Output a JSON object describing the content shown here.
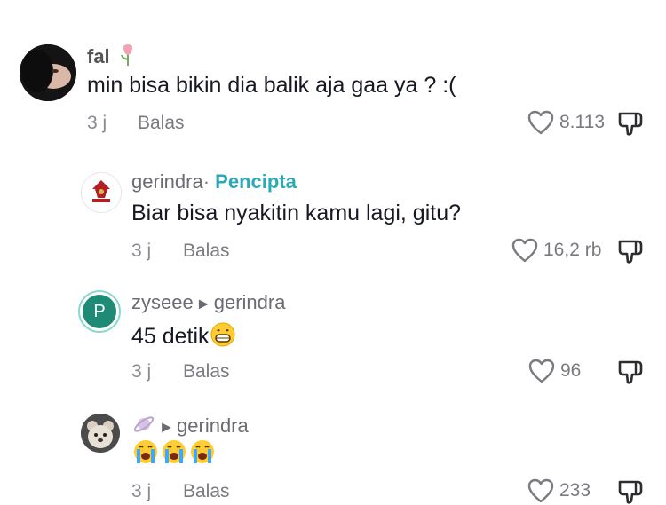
{
  "comments": [
    {
      "author": "fal",
      "text": "min bisa bikin dia balik aja gaa ya ? :(",
      "time": "3 j",
      "reply_label": "Balas",
      "likes": "8.113"
    },
    {
      "author": "gerindra",
      "separator": "·",
      "badge": "Pencipta",
      "text": "Biar bisa nyakitin kamu lagi, gitu?",
      "time": "3 j",
      "reply_label": "Balas",
      "likes": "16,2 rb"
    },
    {
      "author": "zyseee",
      "avatar_letter": "P",
      "reply_to": "gerindra",
      "text": "45 detik",
      "time": "3 j",
      "reply_label": "Balas",
      "likes": "96"
    },
    {
      "author": "",
      "reply_to": "gerindra",
      "text": "",
      "time": "3 j",
      "reply_label": "Balas",
      "likes": "233"
    }
  ],
  "colors": {
    "creator_badge": "#2aa9b6",
    "zyseee_avatar": "#1f8a76",
    "gerindra_red": "#b11f24"
  },
  "icons": [
    "heart-icon",
    "dislike-icon",
    "grin-emoji",
    "crying-emoji",
    "planet-emoji",
    "flower-emoji",
    "play-arrow-icon"
  ]
}
